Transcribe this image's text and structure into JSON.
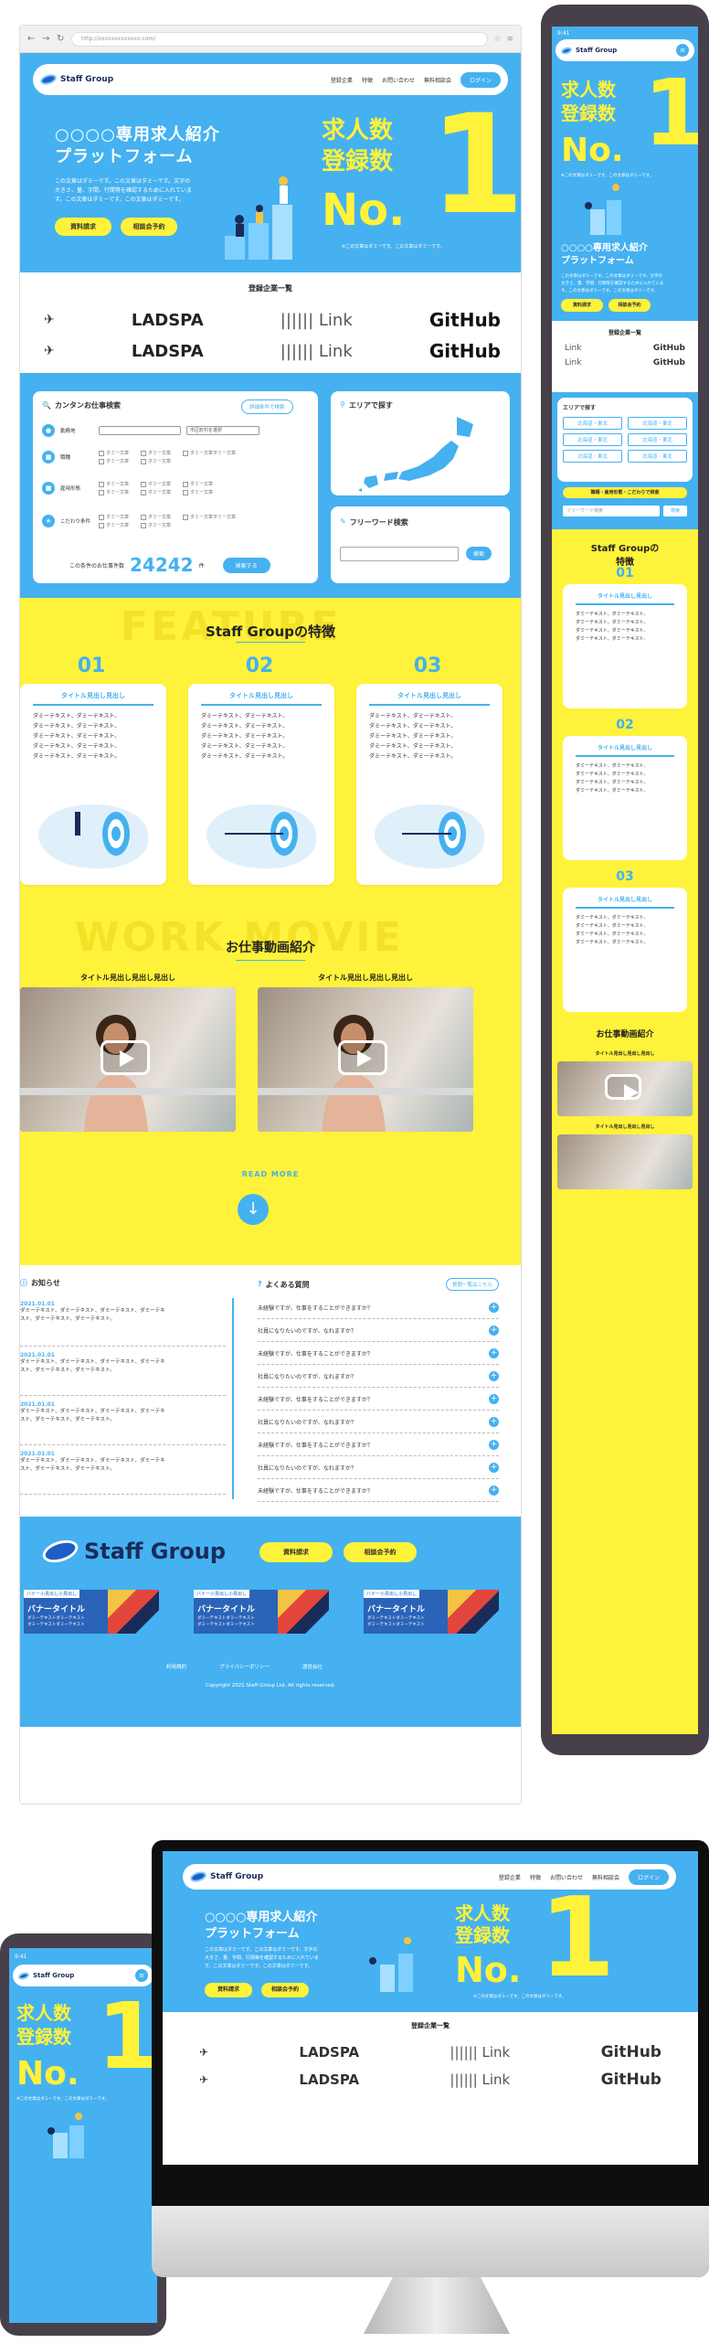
{
  "browser": {
    "url": "http://xxxxxxxxxxxxx.com/",
    "nav": {
      "back": "←",
      "forward": "→",
      "reload": "↻"
    }
  },
  "site": {
    "brand": "Staff Group",
    "nav": [
      "登録企業",
      "特徴",
      "お問い合わせ",
      "無料相談会"
    ],
    "login": "ログイン",
    "hero": {
      "title_line1": "○○○○専用求人紹介",
      "title_line2": "プラットフォーム",
      "body": [
        "この文章はダミーです。この文章はダミーです。文字の",
        "大きさ、量、字間、行間等を確認するために入れていま",
        "す。この文章はダミーです。この文章はダミーです。"
      ],
      "btn_request": "資料請求",
      "btn_consult": "相談会予約",
      "stat1": "求人数",
      "stat2": "登録数",
      "no": "No.",
      "one": "1",
      "note": "※この文章はダミーです。この文章はダミーです。"
    },
    "companies": {
      "title": "登録企業一覧",
      "logos": [
        "LADSPA",
        "Link",
        "GitHub"
      ]
    },
    "search": {
      "title": "カンタンお仕事検索",
      "advanced": "詳細条件で検索",
      "rows": [
        {
          "icon": "■",
          "label": "勤務地",
          "select": "",
          "extra": "市区町村を選択"
        },
        {
          "icon": "■",
          "label": "職種",
          "opts": [
            "ダミー文章",
            "ダミー文章",
            "ダミー文章ダミー文章"
          ]
        },
        {
          "icon": "■",
          "label": "雇用形態",
          "opts": [
            "ダミー文章",
            "ダミー文章",
            "ダミー文章"
          ]
        },
        {
          "icon": "★",
          "label": "こだわり条件",
          "opts": [
            "ダミー文章",
            "ダミー文章",
            "ダミー文章ダミー文章"
          ]
        }
      ],
      "count_prefix": "この条件のお仕事件数",
      "count": "24242",
      "count_suffix": "件",
      "search_btn": "検索する"
    },
    "area": {
      "title": "エリアで探す"
    },
    "freeword": {
      "title": "フリーワード検索",
      "placeholder": "",
      "btn": "検索"
    },
    "feature": {
      "ghost": "FEATURE",
      "title": "Staff Groupの特徴",
      "cards": [
        {
          "num": "01",
          "heading": "タイトル見出し見出し",
          "lines": [
            "ダミーテキスト、ダミーテキスト、",
            "ダミーテキスト、ダミーテキスト、",
            "ダミーテキスト、ダミーテキスト、",
            "ダミーテキスト、ダミーテキスト、",
            "ダミーテキスト、ダミーテキスト。"
          ]
        },
        {
          "num": "02",
          "heading": "タイトル見出し見出し",
          "lines": [
            "ダミーテキスト、ダミーテキスト、",
            "ダミーテキスト、ダミーテキスト、",
            "ダミーテキスト、ダミーテキスト、",
            "ダミーテキスト、ダミーテキスト、",
            "ダミーテキスト、ダミーテキスト。"
          ]
        },
        {
          "num": "03",
          "heading": "タイトル見出し見出し",
          "lines": [
            "ダミーテキスト、ダミーテキスト、",
            "ダミーテキスト、ダミーテキスト、",
            "ダミーテキスト、ダミーテキスト、",
            "ダミーテキスト、ダミーテキスト、",
            "ダミーテキスト、ダミーテキスト。"
          ]
        }
      ]
    },
    "movie": {
      "ghost": "WORK MOVIE",
      "title": "お仕事動画紹介",
      "videos": [
        {
          "title": "タイトル見出し見出し見出し"
        },
        {
          "title": "タイトル見出し見出し見出し"
        }
      ],
      "read_more": "READ MORE"
    },
    "news": {
      "title": "お知らせ",
      "items": [
        {
          "date": "2021.01.01",
          "lines": [
            "ダミーテキスト、ダミーテキスト、ダミーテキスト、ダミーテキ",
            "スト、ダミーテキスト、ダミーテキスト。"
          ]
        },
        {
          "date": "2021.01.01",
          "lines": [
            "ダミーテキスト、ダミーテキスト、ダミーテキスト、ダミーテキ",
            "スト、ダミーテキスト、ダミーテキスト。"
          ]
        },
        {
          "date": "2021.01.01",
          "lines": [
            "ダミーテキスト、ダミーテキスト、ダミーテキスト、ダミーテキ",
            "スト、ダミーテキスト、ダミーテキスト。"
          ]
        },
        {
          "date": "2021.01.01",
          "lines": [
            "ダミーテキスト、ダミーテキスト、ダミーテキスト、ダミーテキ",
            "スト、ダミーテキスト、ダミーテキスト。"
          ]
        }
      ]
    },
    "faq": {
      "title": "よくある質問",
      "more": "質問一覧はこちら",
      "items": [
        "未経験ですが、仕事をすることができますか？",
        "社員になりたいのですが、なれますか？",
        "未経験ですが、仕事をすることができますか？",
        "社員になりたいのですが、なれますか？",
        "未経験ですが、仕事をすることができますか？",
        "社員になりたいのですが、なれますか？",
        "未経験ですが、仕事をすることができますか？",
        "社員になりたいのですが、なれますか？",
        "未経験ですが、仕事をすることができますか？",
        "社員になりたいのですが、なれますか？"
      ]
    },
    "footer": {
      "brand": "Staff Group",
      "btn_request": "資料請求",
      "btn_consult": "相談会予約",
      "banners": [
        {
          "label": "バナー小見出し小見出し",
          "title": "バナータイトル",
          "sub1": "ダミーテキストダミーテキスト",
          "sub2": "ダミーテキストダミーテキスト"
        },
        {
          "label": "バナー小見出し小見出し",
          "title": "バナータイトル",
          "sub1": "ダミーテキストダミーテキスト",
          "sub2": "ダミーテキストダミーテキスト"
        },
        {
          "label": "バナー小見出し小見出し",
          "title": "バナータイトル",
          "sub1": "ダミーテキストダミーテキスト",
          "sub2": "ダミーテキストダミーテキスト"
        }
      ],
      "links": [
        "利用規約",
        "プライバシーポリシー",
        "運営会社"
      ],
      "copyright": "Copyright 2021 Staff-Group Ltd. All rights reserved."
    }
  },
  "mobile": {
    "time": "9:41",
    "areas": [
      "北海道・東北",
      "北海道・東北",
      "北海道・東北",
      "北海道・東北",
      "北海道・東北",
      "北海道・東北",
      "北海道・東北"
    ],
    "cond_btn": "職種・雇用形態・こだわりで検索",
    "freeword_placeholder": "フリーワード検索",
    "freeword_btn": "検索",
    "feature_title1": "Staff Groupの",
    "feature_title2": "特徴"
  },
  "colors": {
    "blue": "#45b1f0",
    "yellow": "#fff23a",
    "navy": "#1a2b5a"
  }
}
